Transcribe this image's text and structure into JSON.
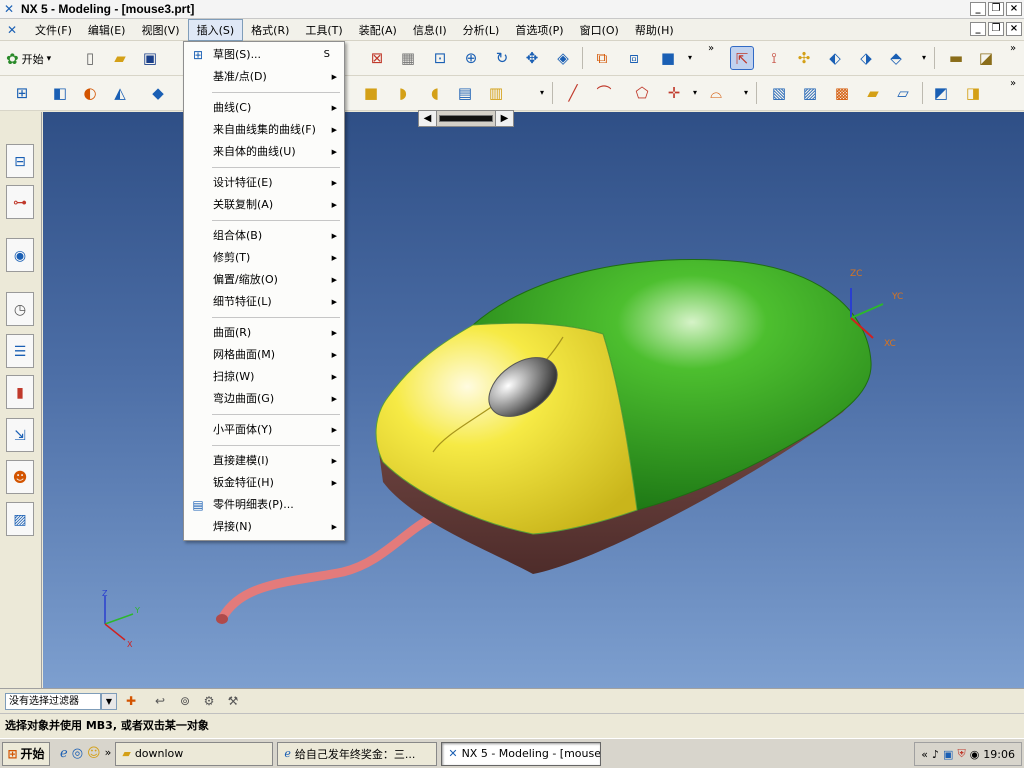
{
  "window": {
    "title": "NX 5 - Modeling - [mouse3.prt]",
    "controls": [
      "_",
      "❐",
      "×"
    ]
  },
  "menubar": {
    "items": [
      "文件(F)",
      "编辑(E)",
      "视图(V)",
      "插入(S)",
      "格式(R)",
      "工具(T)",
      "装配(A)",
      "信息(I)",
      "分析(L)",
      "首选项(P)",
      "窗口(O)",
      "帮助(H)"
    ],
    "open_index": 3,
    "mdi_controls": [
      "_",
      "❐",
      "×"
    ]
  },
  "toolbar": {
    "start_label": "开始",
    "start_arrow": "▾"
  },
  "insert_menu": {
    "groups": [
      [
        {
          "label": "草图(S)...",
          "shortcut": "S",
          "icon": "sketch-icon",
          "arrow": false
        },
        {
          "label": "基准/点(D)",
          "arrow": true
        }
      ],
      [
        {
          "label": "曲线(C)",
          "arrow": true
        },
        {
          "label": "来自曲线集的曲线(F)",
          "arrow": true
        },
        {
          "label": "来自体的曲线(U)",
          "arrow": true
        }
      ],
      [
        {
          "label": "设计特征(E)",
          "arrow": true
        },
        {
          "label": "关联复制(A)",
          "arrow": true
        }
      ],
      [
        {
          "label": "组合体(B)",
          "arrow": true
        },
        {
          "label": "修剪(T)",
          "arrow": true
        },
        {
          "label": "偏置/缩放(O)",
          "arrow": true
        },
        {
          "label": "细节特征(L)",
          "arrow": true
        }
      ],
      [
        {
          "label": "曲面(R)",
          "arrow": true
        },
        {
          "label": "网格曲面(M)",
          "arrow": true
        },
        {
          "label": "扫掠(W)",
          "arrow": true
        },
        {
          "label": "弯边曲面(G)",
          "arrow": true
        }
      ],
      [
        {
          "label": "小平面体(Y)",
          "arrow": true
        }
      ],
      [
        {
          "label": "直接建模(I)",
          "arrow": true
        },
        {
          "label": "钣金特征(H)",
          "arrow": true
        },
        {
          "label": "零件明细表(P)...",
          "icon": "table-icon",
          "arrow": false
        },
        {
          "label": "焊接(N)",
          "arrow": true
        }
      ]
    ]
  },
  "viewport": {
    "wcs_labels": {
      "zc": "ZC",
      "yc": "YC",
      "xc": "XC"
    },
    "abs_labels": {
      "z": "Z",
      "y": "Y",
      "x": "X"
    }
  },
  "selection_bar": {
    "filter_value": "没有选择过滤器"
  },
  "status": {
    "text": "选择对象并使用 MB3, 或者双击某一对象"
  },
  "taskbar": {
    "start": "开始",
    "tasks": [
      {
        "label": "downlow",
        "icon": "folder-icon",
        "active": false
      },
      {
        "label": "给自己发年终奖金：三...",
        "icon": "ie-icon",
        "active": false
      },
      {
        "label": "NX 5 - Modeling - [mouse...",
        "icon": "nx-icon",
        "active": true
      }
    ],
    "overflow": "»",
    "clock": "19:06"
  },
  "colors": {
    "viewport_top": "#2f4f86",
    "viewport_bottom": "#7d9fcf",
    "mouse_green": "#34a620",
    "mouse_yellow": "#f2e33a",
    "mouse_base": "#7a4a46",
    "cable": "#e37b7b"
  }
}
